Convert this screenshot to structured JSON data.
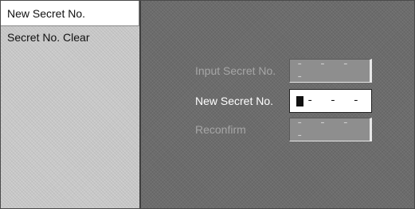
{
  "menu": {
    "items": [
      {
        "label": "New Secret No.",
        "active": true
      },
      {
        "label": "Secret No. Clear",
        "active": false
      }
    ]
  },
  "form": {
    "input_secret": {
      "label": "Input Secret No.",
      "value": "- - - -"
    },
    "new_secret": {
      "label": "New Secret No.",
      "value": "- - -"
    },
    "reconfirm": {
      "label": "Reconfirm",
      "value": "- - - -"
    }
  }
}
